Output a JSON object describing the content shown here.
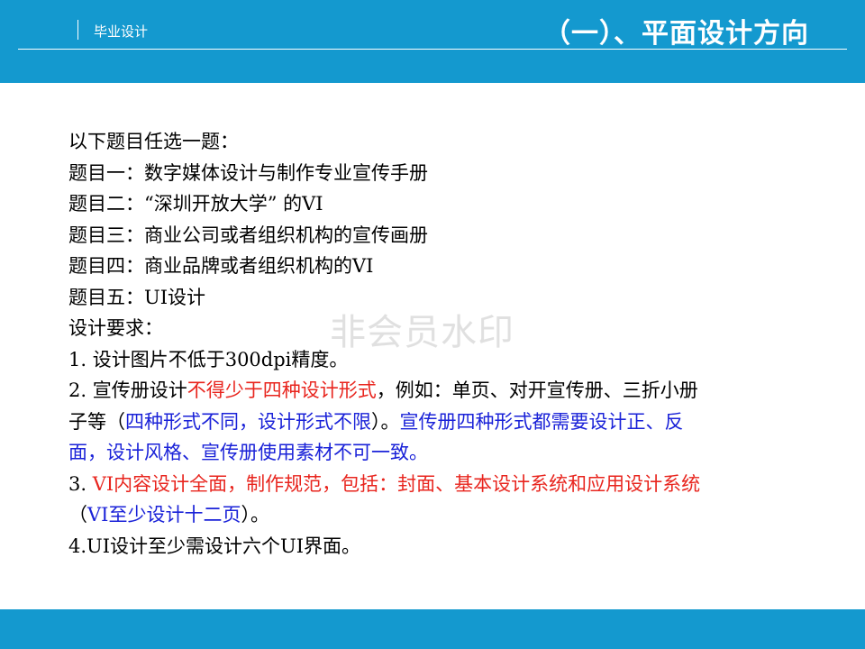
{
  "header": {
    "label": "毕业设计",
    "title": "（一）、平面设计方向"
  },
  "watermark": "非会员水印",
  "content": {
    "intro": "以下题目任选一题：",
    "topics": [
      "题目一：数字媒体设计与制作专业宣传手册",
      "题目二：“深圳开放大学” 的VI",
      "题目三：商业公司或者组织机构的宣传画册",
      "题目四：商业品牌或者组织机构的VI",
      "题目五：UI设计"
    ],
    "requirements_heading": "设计要求：",
    "req1": "1. 设计图片不低于300dpi精度。",
    "req2": {
      "prefix": "2. 宣传册设计",
      "red": "不得少于四种设计形式",
      "middle": "，例如：单页、对开宣传册、三折小册",
      "line2_start": "子等（",
      "blue1": "四种形式不同，设计形式不限",
      "line2_mid": "）。",
      "blue2": "宣传册四种形式都需要设计正、反",
      "blue3": "面，设计风格、宣传册使用素材不可一致。"
    },
    "req3": {
      "prefix": "3. ",
      "red_line1": "VI内容设计全面，制作规范，包括：封面、基本设计系统和应用设计系统",
      "line2_open": "（",
      "blue": "VI至少设计十二页",
      "line2_close": "）。"
    },
    "req4": "4.UI设计至少需设计六个UI界面。"
  }
}
